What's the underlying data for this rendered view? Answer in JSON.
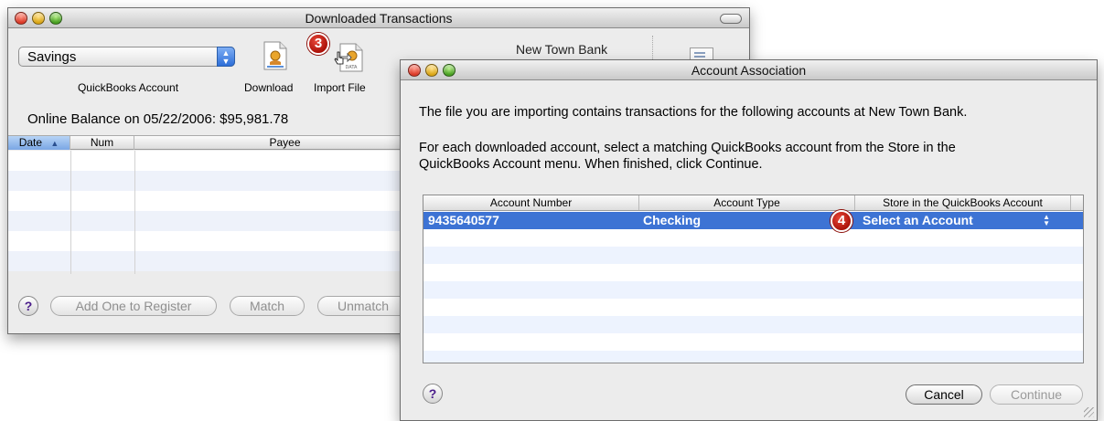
{
  "downloaded_window": {
    "title": "Downloaded Transactions",
    "account_popup": "Savings",
    "account_popup_caption": "QuickBooks Account",
    "download_label": "Download",
    "import_label": "Import File",
    "bank_name": "New Town Bank",
    "balance_text": "Online Balance on 05/22/2006: $95,981.78",
    "columns": [
      "Date",
      "Num",
      "Payee"
    ],
    "sort_indicator": "▲",
    "buttons": {
      "help": "?",
      "add_one": "Add One to Register",
      "match": "Match",
      "unmatch": "Unmatch"
    }
  },
  "account_window": {
    "title": "Account Association",
    "message_1": "The file you are importing contains transactions for the following accounts at New Town Bank.",
    "message_2_line1": "For each downloaded account, select a matching QuickBooks account from the Store in the",
    "message_2_line2": "QuickBooks Account menu. When finished, click Continue.",
    "columns": [
      "Account Number",
      "Account Type",
      "Store in the QuickBooks Account"
    ],
    "rows": [
      {
        "account_number": "9435640577",
        "account_type": "Checking",
        "store_in": "Select an Account"
      }
    ],
    "buttons": {
      "help": "?",
      "cancel": "Cancel",
      "continue": "Continue"
    }
  },
  "badges": {
    "step3": "3",
    "step4": "4"
  },
  "colors": {
    "selection": "#3d73d4",
    "badge": "#c0160c",
    "alt_row": "#edf3fe"
  }
}
